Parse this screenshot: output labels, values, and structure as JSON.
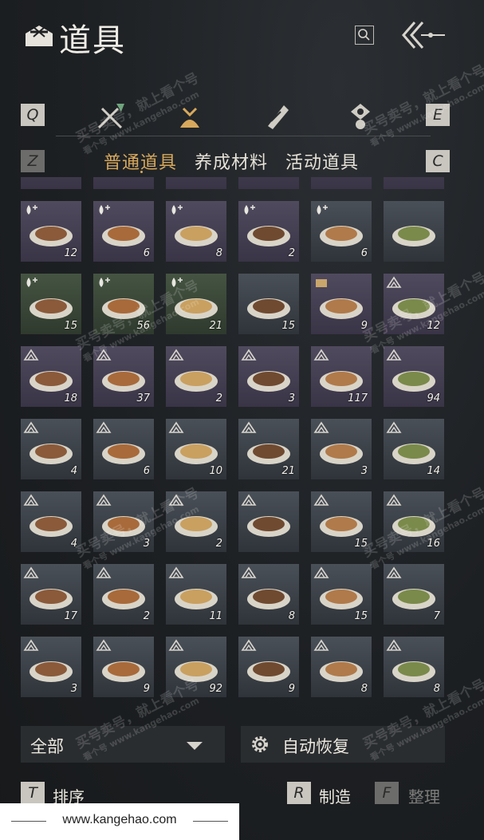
{
  "header": {
    "title": "道具"
  },
  "tabs": {
    "left_key": "Q",
    "right_key": "E"
  },
  "subtabs": {
    "left_key": "Z",
    "right_key": "C",
    "items": [
      "普通道具",
      "养成材料",
      "活动道具"
    ]
  },
  "colors": {
    "accent": "#d8a95c",
    "slot_purple": "#504a5e",
    "slot_green": "#455442",
    "slot_gray": "#4a5058"
  },
  "items": [
    {
      "count": "12",
      "tier": "purple",
      "badge": "drop"
    },
    {
      "count": "6",
      "tier": "purple",
      "badge": "drop"
    },
    {
      "count": "8",
      "tier": "purple",
      "badge": "drop"
    },
    {
      "count": "2",
      "tier": "purple",
      "badge": "drop"
    },
    {
      "count": "6",
      "tier": "gray",
      "badge": "drop"
    },
    {
      "count": "",
      "tier": "gray",
      "badge": "none"
    },
    {
      "count": "15",
      "tier": "green",
      "badge": "drop"
    },
    {
      "count": "56",
      "tier": "green",
      "badge": "drop"
    },
    {
      "count": "21",
      "tier": "green",
      "badge": "drop"
    },
    {
      "count": "15",
      "tier": "gray",
      "badge": "none"
    },
    {
      "count": "9",
      "tier": "purple",
      "badge": "box"
    },
    {
      "count": "12",
      "tier": "purple",
      "badge": "mountain"
    },
    {
      "count": "18",
      "tier": "purple",
      "badge": "mountain"
    },
    {
      "count": "37",
      "tier": "purple",
      "badge": "mountain"
    },
    {
      "count": "2",
      "tier": "purple",
      "badge": "mountain"
    },
    {
      "count": "3",
      "tier": "purple",
      "badge": "mountain"
    },
    {
      "count": "117",
      "tier": "purple",
      "badge": "mountain"
    },
    {
      "count": "94",
      "tier": "purple",
      "badge": "mountain"
    },
    {
      "count": "4",
      "tier": "gray",
      "badge": "mountain"
    },
    {
      "count": "6",
      "tier": "gray",
      "badge": "mountain"
    },
    {
      "count": "10",
      "tier": "gray",
      "badge": "mountain"
    },
    {
      "count": "21",
      "tier": "gray",
      "badge": "mountain"
    },
    {
      "count": "3",
      "tier": "gray",
      "badge": "mountain"
    },
    {
      "count": "14",
      "tier": "gray",
      "badge": "mountain"
    },
    {
      "count": "4",
      "tier": "gray",
      "badge": "mountain"
    },
    {
      "count": "3",
      "tier": "gray",
      "badge": "mountain"
    },
    {
      "count": "2",
      "tier": "gray",
      "badge": "mountain"
    },
    {
      "count": "",
      "tier": "gray",
      "badge": "mountain"
    },
    {
      "count": "15",
      "tier": "gray",
      "badge": "mountain"
    },
    {
      "count": "16",
      "tier": "gray",
      "badge": "mountain"
    },
    {
      "count": "17",
      "tier": "gray",
      "badge": "mountain"
    },
    {
      "count": "2",
      "tier": "gray",
      "badge": "mountain"
    },
    {
      "count": "11",
      "tier": "gray",
      "badge": "mountain"
    },
    {
      "count": "8",
      "tier": "gray",
      "badge": "mountain"
    },
    {
      "count": "15",
      "tier": "gray",
      "badge": "mountain"
    },
    {
      "count": "7",
      "tier": "gray",
      "badge": "mountain"
    },
    {
      "count": "3",
      "tier": "gray",
      "badge": "mountain"
    },
    {
      "count": "9",
      "tier": "gray",
      "badge": "mountain"
    },
    {
      "count": "92",
      "tier": "gray",
      "badge": "mountain"
    },
    {
      "count": "9",
      "tier": "gray",
      "badge": "mountain"
    },
    {
      "count": "8",
      "tier": "gray",
      "badge": "mountain"
    },
    {
      "count": "8",
      "tier": "gray",
      "badge": "mountain"
    }
  ],
  "filter": {
    "label": "全部"
  },
  "auto_recover": {
    "label": "自动恢复"
  },
  "actions": {
    "sort_key": "T",
    "sort_label": "排序",
    "craft_key": "R",
    "craft_label": "制造",
    "tidy_key": "F",
    "tidy_label": "整理"
  },
  "watermark": {
    "main": "买号卖号，就上看个号",
    "sub": "看个号  www.kangehao.com"
  },
  "footer": {
    "url": "www.kangehao.com"
  }
}
